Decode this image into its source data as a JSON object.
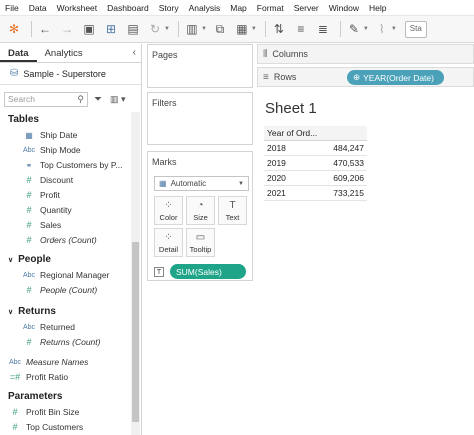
{
  "menu": [
    "File",
    "Data",
    "Worksheet",
    "Dashboard",
    "Story",
    "Analysis",
    "Map",
    "Format",
    "Server",
    "Window",
    "Help"
  ],
  "toolbar": {
    "partial_label": "Sta",
    "icons": [
      "tableau-logo-icon",
      "undo-icon",
      "redo-icon",
      "save-icon",
      "new-data-source-icon",
      "pause-updates-icon",
      "refresh-icon",
      "new-worksheet-icon",
      "duplicate-icon",
      "clear-sheet-icon",
      "swap-icon",
      "sort-asc-icon",
      "sort-desc-icon",
      "highlight-icon",
      "pin-icon",
      "group-icon",
      "show-labels-icon",
      "fit-icon"
    ]
  },
  "left": {
    "tabs": [
      "Data",
      "Analytics"
    ],
    "datasource": "Sample - Superstore",
    "search_placeholder": "Search",
    "sections": {
      "tables": "Tables",
      "people": "People",
      "returns": "Returns",
      "parameters": "Parameters"
    },
    "fields": {
      "ship_date": "Ship Date",
      "ship_mode": "Ship Mode",
      "top_customers_by": "Top Customers by P...",
      "discount": "Discount",
      "profit": "Profit",
      "quantity": "Quantity",
      "sales": "Sales",
      "orders_count": "Orders (Count)",
      "regional_manager": "Regional Manager",
      "people_count": "People (Count)",
      "returned": "Returned",
      "returns_count": "Returns (Count)",
      "measure_names": "Measure Names",
      "profit_ratio": "Profit Ratio",
      "profit_bin_size": "Profit Bin Size",
      "top_customers": "Top Customers"
    }
  },
  "cards": {
    "pages": "Pages",
    "filters": "Filters",
    "marks": "Marks",
    "mark_type": "Automatic",
    "buttons": {
      "color": "Color",
      "size": "Size",
      "text": "Text",
      "detail": "Detail",
      "tooltip": "Tooltip"
    },
    "text_pill": "SUM(Sales)"
  },
  "shelves": {
    "columns": "Columns",
    "rows": "Rows",
    "rows_pill": "YEAR(Order Date)"
  },
  "view": {
    "sheet_title": "Sheet 1",
    "header": "Year of Ord...",
    "rows": [
      {
        "year": "2018",
        "value": "484,247"
      },
      {
        "year": "2019",
        "value": "470,533"
      },
      {
        "year": "2020",
        "value": "609,206"
      },
      {
        "year": "2021",
        "value": "733,215"
      }
    ]
  }
}
